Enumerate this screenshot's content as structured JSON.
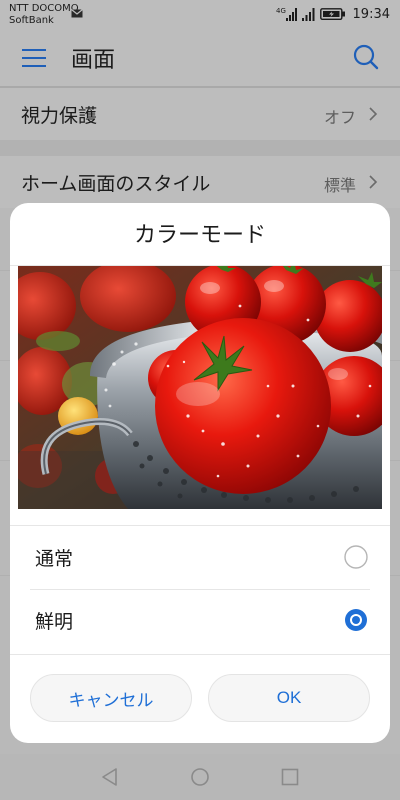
{
  "status_bar": {
    "carrier_line1": "NTT DOCOMO",
    "carrier_line2": "SoftBank",
    "network": "4G",
    "time": "19:34",
    "icons": [
      "mail-icon",
      "signal-4g-icon",
      "signal-icon",
      "battery-charging-icon"
    ]
  },
  "app_bar": {
    "title": "画面",
    "menu_icon": "hamburger-menu-icon",
    "search_icon": "search-icon"
  },
  "settings": {
    "rows": [
      {
        "label": "視力保護",
        "value": "オフ"
      },
      {
        "label": "ホーム画面のスタイル",
        "value": "標準"
      }
    ]
  },
  "dialog": {
    "title": "カラーモード",
    "preview_image": "tomatoes-in-colander",
    "options": [
      {
        "label": "通常",
        "selected": false
      },
      {
        "label": "鮮明",
        "selected": true
      }
    ],
    "cancel_label": "キャンセル",
    "ok_label": "OK"
  },
  "nav_bar": {
    "icons": [
      "back-icon",
      "home-icon",
      "recents-icon"
    ]
  },
  "colors": {
    "accent": "#1f6fd6",
    "scrim": "#bdbdbd",
    "dialog_bg": "#ffffff"
  }
}
